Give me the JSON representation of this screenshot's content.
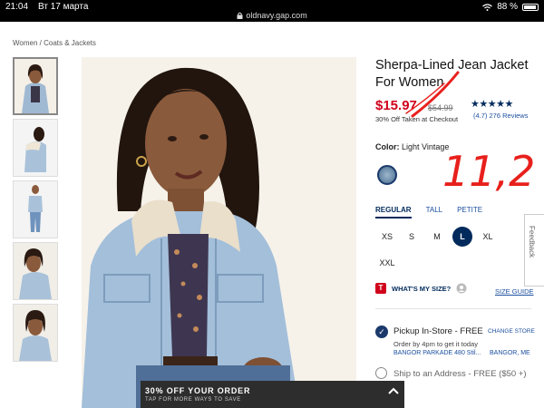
{
  "status": {
    "time": "21:04",
    "date": "Вт 17 марта",
    "battery": "88 %"
  },
  "browser": {
    "url": "oldnavy.gap.com"
  },
  "breadcrumb": "Women / Coats & Jackets",
  "product": {
    "title": "Sherpa-Lined Jean Jacket For Women",
    "sale_price": "$15.97",
    "original_price": "$54.99",
    "promo": "30% Off Taken at Checkout",
    "rating": 4.7,
    "stars": "★★★★★",
    "reviews": "(4.7) 276 Reviews",
    "color_label": "Color:",
    "color_value": "Light Vintage"
  },
  "fit_tabs": [
    "REGULAR",
    "TALL",
    "PETITE"
  ],
  "sizes": [
    "XS",
    "S",
    "M",
    "L",
    "XL",
    "XXL"
  ],
  "selected_size": "L",
  "whats_my_size": {
    "badge": "T",
    "label": "WHAT'S MY SIZE?"
  },
  "size_guide": "SIZE GUIDE",
  "pickup": {
    "title": "Pickup In-Store - FREE",
    "change_store": "CHANGE STORE",
    "order_by": "Order by 4pm to get it today",
    "store": "BANGOR PARKADE 480 Stil...",
    "city": "BANGOR, ME"
  },
  "ship": "Ship to an Address - FREE ($50 +)",
  "feedback": "Feedback",
  "banner": {
    "title": "30% OFF YOUR ORDER",
    "subtitle": "TAP FOR MORE WAYS TO SAVE"
  },
  "handwritten": "11,2",
  "colors": {
    "sale_red": "#d0021b",
    "navy": "#002a5c",
    "link_blue": "#1b4fa0",
    "annotation_red": "#e8201c"
  },
  "icons": [
    "lock-icon",
    "wifi-icon",
    "battery-icon",
    "star-icon",
    "checkmark-icon",
    "chevron-up-icon"
  ]
}
